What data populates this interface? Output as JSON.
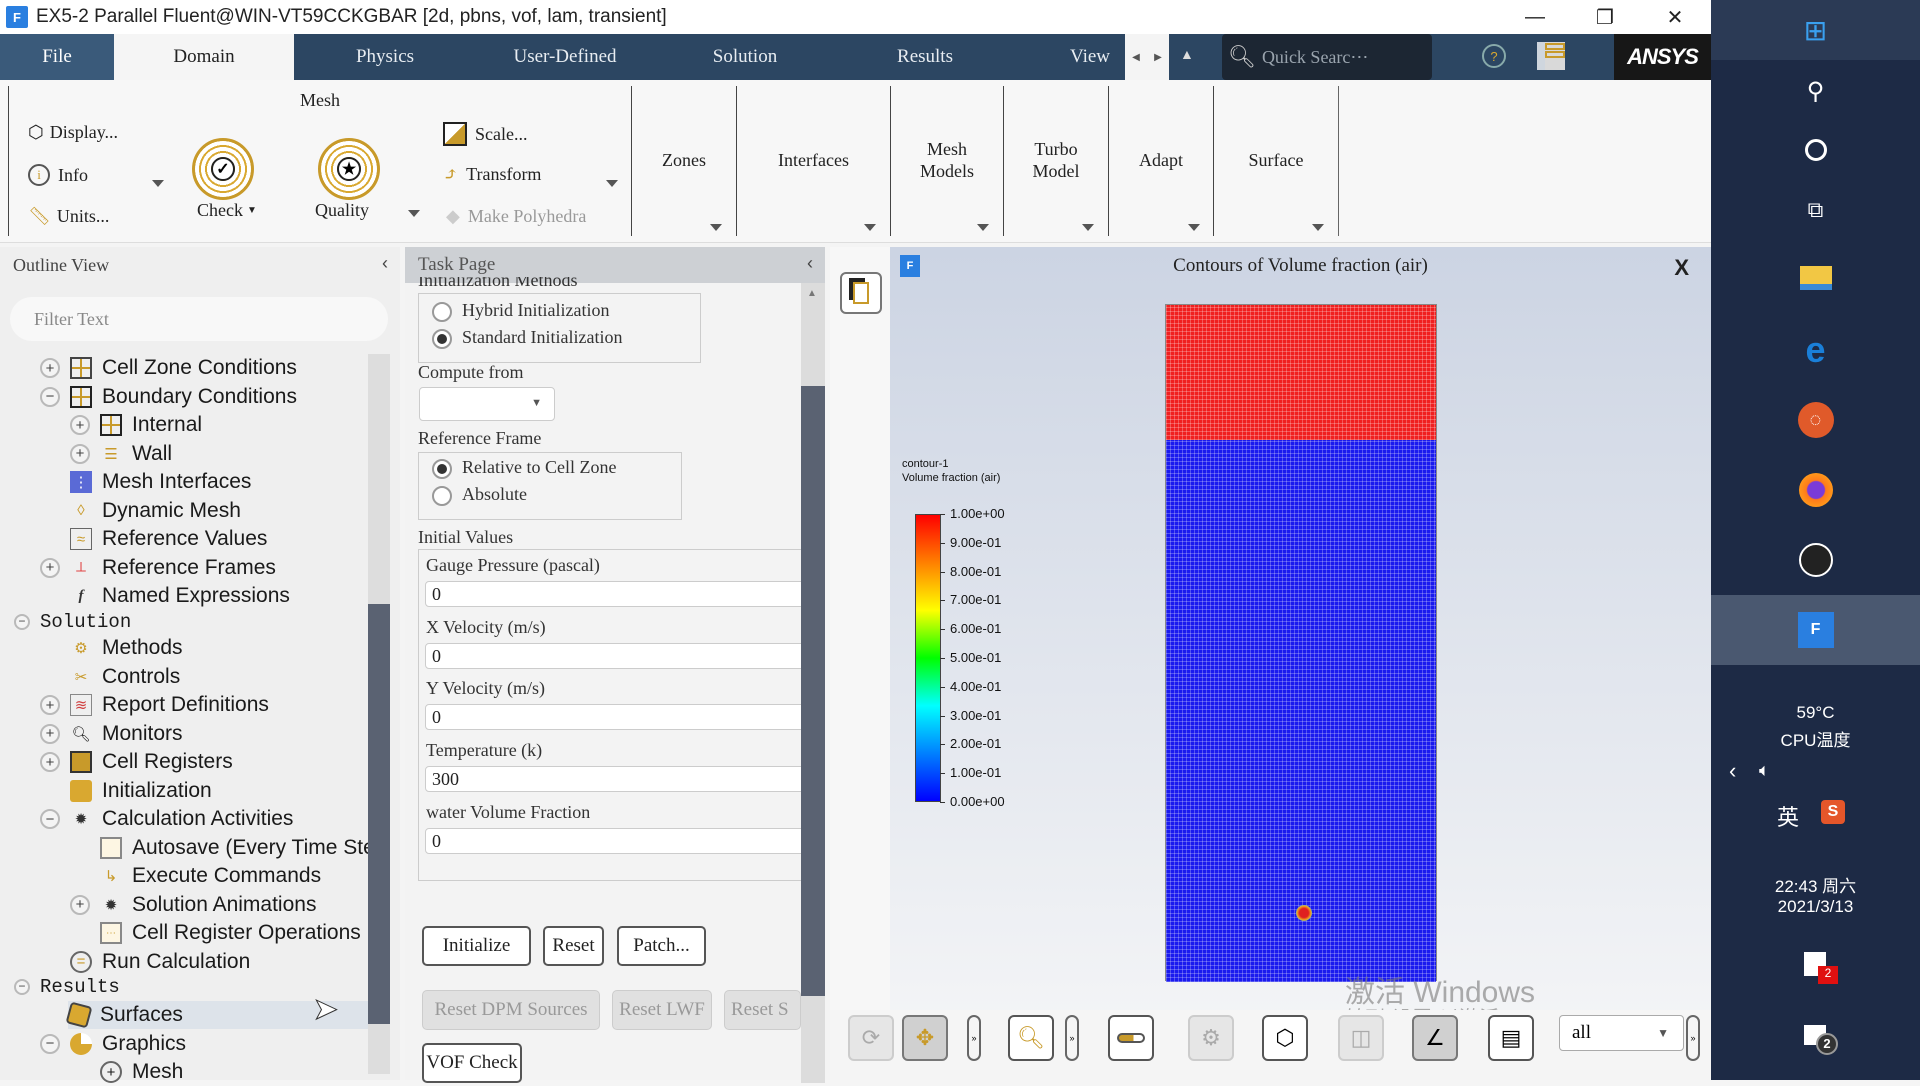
{
  "window": {
    "title": "EX5-2 Parallel Fluent@WIN-VT59CCKGBAR  [2d, pbns, vof, lam, transient]",
    "logo": "F",
    "controls": {
      "minimize": "—",
      "restore": "❐",
      "close": "✕"
    }
  },
  "tabs": [
    {
      "label": "File"
    },
    {
      "label": "Domain",
      "active": true
    },
    {
      "label": "Physics"
    },
    {
      "label": "User-Defined"
    },
    {
      "label": "Solution"
    },
    {
      "label": "Results"
    },
    {
      "label": "View"
    }
  ],
  "search": {
    "placeholder": "Quick Searc⋯"
  },
  "brand": "ANSYS",
  "ribbon": {
    "mesh_group": "Mesh",
    "display": "Display...",
    "info": "Info",
    "units": "Units...",
    "check": "Check",
    "quality": "Quality",
    "scale": "Scale...",
    "transform": "Transform",
    "make_polyhedra": "Make Polyhedra",
    "groups": [
      "Zones",
      "Interfaces",
      "Mesh\nModels",
      "Turbo\nModel",
      "Adapt",
      "Surface"
    ]
  },
  "outline": {
    "title": "Outline View",
    "filter_placeholder": "Filter Text",
    "items": [
      {
        "label": "Cell Zone Conditions",
        "expander": "+"
      },
      {
        "label": "Boundary Conditions",
        "expander": "−"
      },
      {
        "label": "Internal",
        "expander": "+"
      },
      {
        "label": "Wall",
        "expander": "+"
      },
      {
        "label": "Mesh Interfaces"
      },
      {
        "label": "Dynamic Mesh"
      },
      {
        "label": "Reference Values"
      },
      {
        "label": "Reference Frames",
        "expander": "+"
      },
      {
        "label": "Named Expressions"
      },
      {
        "label": "Solution",
        "expander": "−"
      },
      {
        "label": "Methods"
      },
      {
        "label": "Controls"
      },
      {
        "label": "Report Definitions",
        "expander": "+"
      },
      {
        "label": "Monitors",
        "expander": "+"
      },
      {
        "label": "Cell Registers",
        "expander": "+"
      },
      {
        "label": "Initialization"
      },
      {
        "label": "Calculation Activities",
        "expander": "−"
      },
      {
        "label": "Autosave (Every Time Ste"
      },
      {
        "label": "Execute Commands"
      },
      {
        "label": "Solution Animations",
        "expander": "+"
      },
      {
        "label": "Cell Register Operations"
      },
      {
        "label": "Run Calculation"
      },
      {
        "label": "Results",
        "expander": "−"
      },
      {
        "label": "Surfaces",
        "selected": true
      },
      {
        "label": "Graphics",
        "expander": "−"
      },
      {
        "label": "Mesh"
      }
    ]
  },
  "taskpage": {
    "title": "Task Page",
    "init_methods_label": "Initialization Methods",
    "hybrid": "Hybrid  Initialization",
    "standard": "Standard Initialization",
    "init_method_selected": "Standard Initialization",
    "compute_from_label": "Compute from",
    "compute_from_value": "",
    "ref_frame_label": "Reference Frame",
    "relative": "Relative to Cell Zone",
    "absolute": "Absolute",
    "ref_frame_selected": "Relative to Cell Zone",
    "initial_values_label": "Initial Values",
    "fields": [
      {
        "label": "Gauge Pressure (pascal)",
        "value": "0"
      },
      {
        "label": "X Velocity (m/s)",
        "value": "0"
      },
      {
        "label": "Y Velocity (m/s)",
        "value": "0"
      },
      {
        "label": "Temperature (k)",
        "value": "300"
      },
      {
        "label": "water Volume Fraction",
        "value": "0"
      }
    ],
    "buttons": {
      "initialize": "Initialize",
      "reset": "Reset",
      "patch": "Patch...",
      "reset_dpm": "Reset DPM Sources",
      "reset_lwf": "Reset LWF",
      "reset_s": "Reset S",
      "vof_check": "VOF Check"
    }
  },
  "graphics": {
    "title": "Contours of Volume fraction (air)",
    "close": "X",
    "legend_name": "contour-1",
    "legend_var": "Volume fraction (air)",
    "ticks": [
      "1.00e+00",
      "9.00e-01",
      "8.00e-01",
      "7.00e-01",
      "6.00e-01",
      "5.00e-01",
      "4.00e-01",
      "3.00e-01",
      "2.00e-01",
      "1.00e-01",
      "0.00e+00"
    ],
    "colors": {
      "air": "#f02020",
      "water": "#1a1aee"
    },
    "watermark_1": "激活 Windows",
    "watermark_2": "转到\"设置\"以激活 Windows。"
  },
  "toolbar": {
    "view_select": "all"
  },
  "taskbar": {
    "temp": "59°C",
    "temp_label": "CPU温度",
    "ime": "英",
    "time": "22:43 周六",
    "date": "2021/3/13",
    "notif_count": "2",
    "action_center_count": "2"
  }
}
